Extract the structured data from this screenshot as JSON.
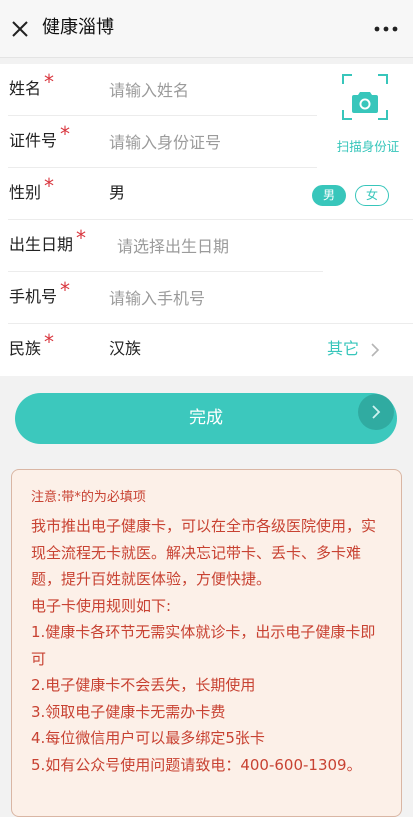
{
  "header": {
    "title": "健康淄博"
  },
  "form": {
    "name": {
      "label": "姓名",
      "required_mark": "*",
      "placeholder": "请输入姓名"
    },
    "id_number": {
      "label": "证件号",
      "required_mark": "*",
      "placeholder": "请输入身份证号"
    },
    "scan": {
      "label": "扫描身份证",
      "icon": "camera-icon"
    },
    "gender": {
      "label": "性别",
      "required_mark": "*",
      "value": "男",
      "options": [
        "男",
        "女"
      ],
      "selected": "男"
    },
    "birthdate": {
      "label": "出生日期",
      "required_mark": "*",
      "placeholder": "请选择出生日期"
    },
    "phone": {
      "label": "手机号",
      "required_mark": "*",
      "placeholder": "请输入手机号"
    },
    "ethnicity": {
      "label": "民族",
      "required_mark": "*",
      "value": "汉族",
      "other_label": "其它"
    }
  },
  "submit": {
    "label": "完成"
  },
  "notice": {
    "title": "注意:带*的为必填项",
    "intro": "我市推出电子健康卡，可以在全市各级医院使用，实现全流程无卡就医。解决忘记带卡、丢卡、多卡难题，提升百姓就医体验，方便快捷。",
    "rules_heading": "电子卡使用规则如下:",
    "rules": [
      "1.健康卡各环节无需实体就诊卡，出示电子健康卡即可",
      "2.电子健康卡不会丢失，长期使用",
      "3.领取电子健康卡无需办卡费",
      "4.每位微信用户可以最多绑定5张卡",
      "5.如有公众号使用问题请致电：400-600-1309。"
    ]
  },
  "colors": {
    "accent": "#3cc8bd",
    "required": "#d9363e",
    "notice_text": "#c84232",
    "notice_bg": "#fcf0e8"
  }
}
